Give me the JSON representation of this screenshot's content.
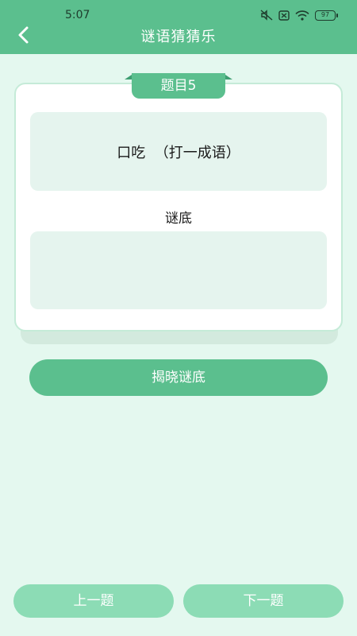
{
  "status_bar": {
    "time": "5:07",
    "battery": "97"
  },
  "header": {
    "title": "谜语猜猜乐",
    "back_icon": "chevron-left-icon"
  },
  "card": {
    "tab_label": "题目5",
    "question": "口吃  （打一成语）",
    "answer_label": "谜底",
    "answer": ""
  },
  "actions": {
    "reveal_label": "揭晓谜底",
    "prev_label": "上一题",
    "next_label": "下一题"
  },
  "colors": {
    "primary": "#5bbf8e",
    "background": "#e4f8ef",
    "nav_button": "#8cdcb5",
    "box": "#e5f4ee"
  }
}
